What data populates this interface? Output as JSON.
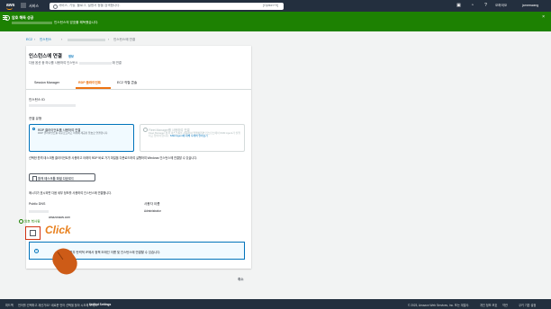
{
  "topbar": {
    "logo": "aws",
    "services": "서비스",
    "search_placeholder": "서비스, 기능, 블로그, 설명서 등을 검색합니다.",
    "search_shortcut": "[Option+S]",
    "region": "오하이오",
    "account": "jameswang"
  },
  "flash": {
    "title": "암호 해독 성공",
    "message_suffix": "인스턴스의 암호를 해독했습니다."
  },
  "breadcrumb": {
    "ec2": "EC2",
    "instances": "인스턴스",
    "current": "인스턴스에 연결"
  },
  "panel": {
    "title": "인스턴스에 연결",
    "info": "정보",
    "subtitle_prefix": "다음 옵션 중 하나를 사용하여 인스턴스",
    "subtitle_suffix": "에 연결"
  },
  "tabs": [
    {
      "label": "Session Manager"
    },
    {
      "label": "RDP 클라이언트"
    },
    {
      "label": "EC2 직렬 콘솔"
    }
  ],
  "instance_id_label": "인스턴스 ID",
  "connection_type_label": "연결 유형",
  "options": [
    {
      "title": "RDP 클라이언트를 사용하여 연결",
      "desc": "RDP 클라이언트를 다운로드하고 아래에 제공된 암호로 연결합니다."
    },
    {
      "title": "Fleet Manager를 사용하여 연결",
      "desc": "Fleet Manager 원격 데스크톱을 사용하여 연결하려면 인스턴스에서 SSM Agent가 실행되고 있어야 합니다.",
      "link": "SSM Agent에 대해 자세히 알아보기"
    }
  ],
  "instructions": "선택한 원격 데스크톱 클라이언트를 사용하고 아래의 RDP 바로 가기 파일을 다운로드하여 실행하여 Windows 인스턴스에 연결할 수 있습니다.",
  "download_button": "원격 데스크톱 파일 다운로드",
  "prompt_text": "메시지가 표시되면 다음 세부 정보를 사용하여 인스턴스에 연결합니다.",
  "public_dns_label": "Public DNS",
  "public_dns_suffix": "amazonaws.com",
  "username_label": "사용자 이름",
  "username": "Administrator",
  "copied_label": "암호 복사됨",
  "click_annotation": "Click",
  "alert_text": "에 할당된 경우 탄력적 IP에서 정책 도메인 이름 및 인스턴스에 연결할 수 있습니다.",
  "cancel": "취소",
  "footer": {
    "feedback": "피드백",
    "language_notice": "언어를 선택하고 계신가요? 새로운 언어 선택을 찾아 시도해 보세요.",
    "unified_settings": "Unified Settings",
    "copyright": "© 2023, Amazon Web Services, Inc. 또는 계열사.",
    "privacy": "개인 정보 보호",
    "terms": "약관",
    "cookie": "쿠키 기본 설정"
  }
}
